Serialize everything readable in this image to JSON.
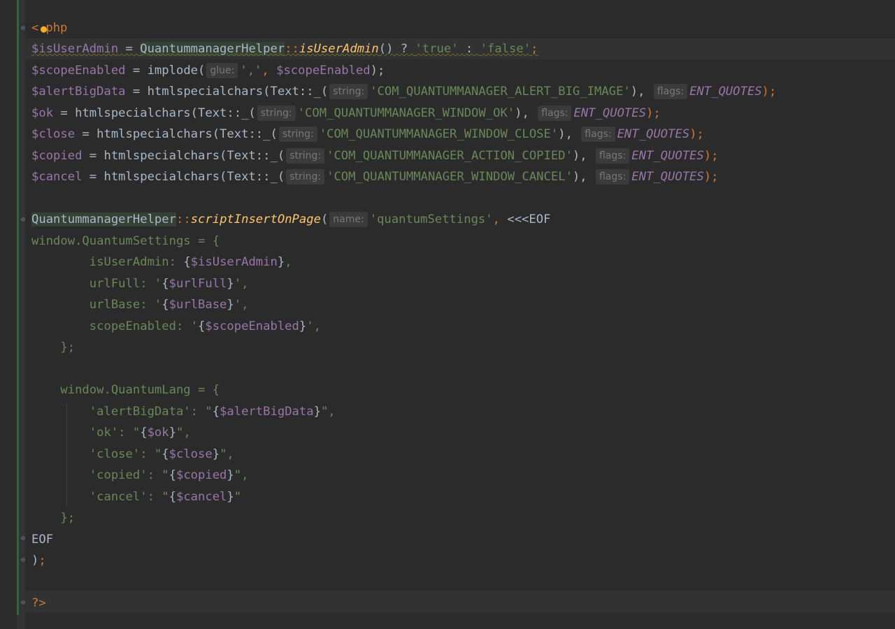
{
  "editor": {
    "lines": {
      "l1": {
        "open": "<",
        "php": "php"
      },
      "l2": {
        "var": "$isUserAdmin",
        "eq": " = ",
        "cls": "QuantummanagerHelper",
        "sep": "::",
        "fn": "isUserAdmin",
        "rest": "() ? ",
        "s1": "'true'",
        "colon": " : ",
        "s2": "'false'",
        "semi": ";"
      },
      "l3": {
        "var": "$scopeEnabled",
        "eq": " = implode(",
        "hint": "glue:",
        "s1": "','",
        "comma": ", ",
        "var2": "$scopeEnabled",
        "end": ");"
      },
      "l4": {
        "var": "$alertBigData",
        "pre": " = htmlspecialchars(Text::_(",
        "hint1": "string:",
        "str": "'COM_QUANTUMMANAGER_ALERT_BIG_IMAGE'",
        "mid": "), ",
        "hint2": "flags:",
        "const": "ENT_QUOTES",
        "end": ");"
      },
      "l5": {
        "var": "$ok",
        "pre": " = htmlspecialchars(Text::_(",
        "hint1": "string:",
        "str": "'COM_QUANTUMMANAGER_WINDOW_OK'",
        "mid": "), ",
        "hint2": "flags:",
        "const": "ENT_QUOTES",
        "end": ");"
      },
      "l6": {
        "var": "$close",
        "pre": " = htmlspecialchars(Text::_(",
        "hint1": "string:",
        "str": "'COM_QUANTUMMANAGER_WINDOW_CLOSE'",
        "mid": "), ",
        "hint2": "flags:",
        "const": "ENT_QUOTES",
        "end": ");"
      },
      "l7": {
        "var": "$copied",
        "pre": " = htmlspecialchars(Text::_(",
        "hint1": "string:",
        "str": "'COM_QUANTUMMANAGER_ACTION_COPIED'",
        "mid": "), ",
        "hint2": "flags:",
        "const": "ENT_QUOTES",
        "end": ");"
      },
      "l8": {
        "var": "$cancel",
        "pre": " = htmlspecialchars(Text::_(",
        "hint1": "string:",
        "str": "'COM_QUANTUMMANAGER_WINDOW_CANCEL'",
        "mid": "), ",
        "hint2": "flags:",
        "const": "ENT_QUOTES",
        "end": ");"
      },
      "l10": {
        "cls": "QuantummanagerHelper",
        "sep": "::",
        "fn": "scriptInsertOnPage",
        "open": "(",
        "hint": "name:",
        "str": "'quantumSettings'",
        "comma": ", ",
        "heredoc": "<<<EOF"
      },
      "l11": {
        "text": "window.QuantumSettings = {"
      },
      "l12": {
        "key": "        isUserAdmin: ",
        "ob": "{",
        "var": "$isUserAdmin",
        "cb": "}",
        "tail": ","
      },
      "l13": {
        "key": "        urlFull: '",
        "ob": "{",
        "var": "$urlFull",
        "cb": "}",
        "tail": "',"
      },
      "l14": {
        "key": "        urlBase: '",
        "ob": "{",
        "var": "$urlBase",
        "cb": "}",
        "tail": "',"
      },
      "l15": {
        "key": "        scopeEnabled: '",
        "ob": "{",
        "var": "$scopeEnabled",
        "cb": "}",
        "tail": "',"
      },
      "l16": {
        "text": "    };"
      },
      "l18": {
        "text": "    window.QuantumLang = {"
      },
      "l19": {
        "key": "        'alertBigData': \"",
        "ob": "{",
        "var": "$alertBigData",
        "cb": "}",
        "tail": "\","
      },
      "l20": {
        "key": "        'ok': \"",
        "ob": "{",
        "var": "$ok",
        "cb": "}",
        "tail": "\","
      },
      "l21": {
        "key": "        'close': \"",
        "ob": "{",
        "var": "$close",
        "cb": "}",
        "tail": "\","
      },
      "l22": {
        "key": "        'copied': \"",
        "ob": "{",
        "var": "$copied",
        "cb": "}",
        "tail": "\","
      },
      "l23": {
        "key": "        'cancel': \"",
        "ob": "{",
        "var": "$cancel",
        "cb": "}",
        "tail": "\""
      },
      "l24": {
        "text": "    };"
      },
      "l25": {
        "text": "EOF"
      },
      "l26": {
        "text": ");"
      },
      "l28": {
        "text": "?>"
      }
    },
    "icons": {
      "intention_bulb": "lightbulb-icon",
      "fold": "fold-marker-icon"
    },
    "colors": {
      "background": "#2b2b2b",
      "keyword": "#cc7832",
      "variable": "#9876aa",
      "string": "#6a8759",
      "static_method": "#ffc66d",
      "default": "#a9b7c6"
    }
  }
}
